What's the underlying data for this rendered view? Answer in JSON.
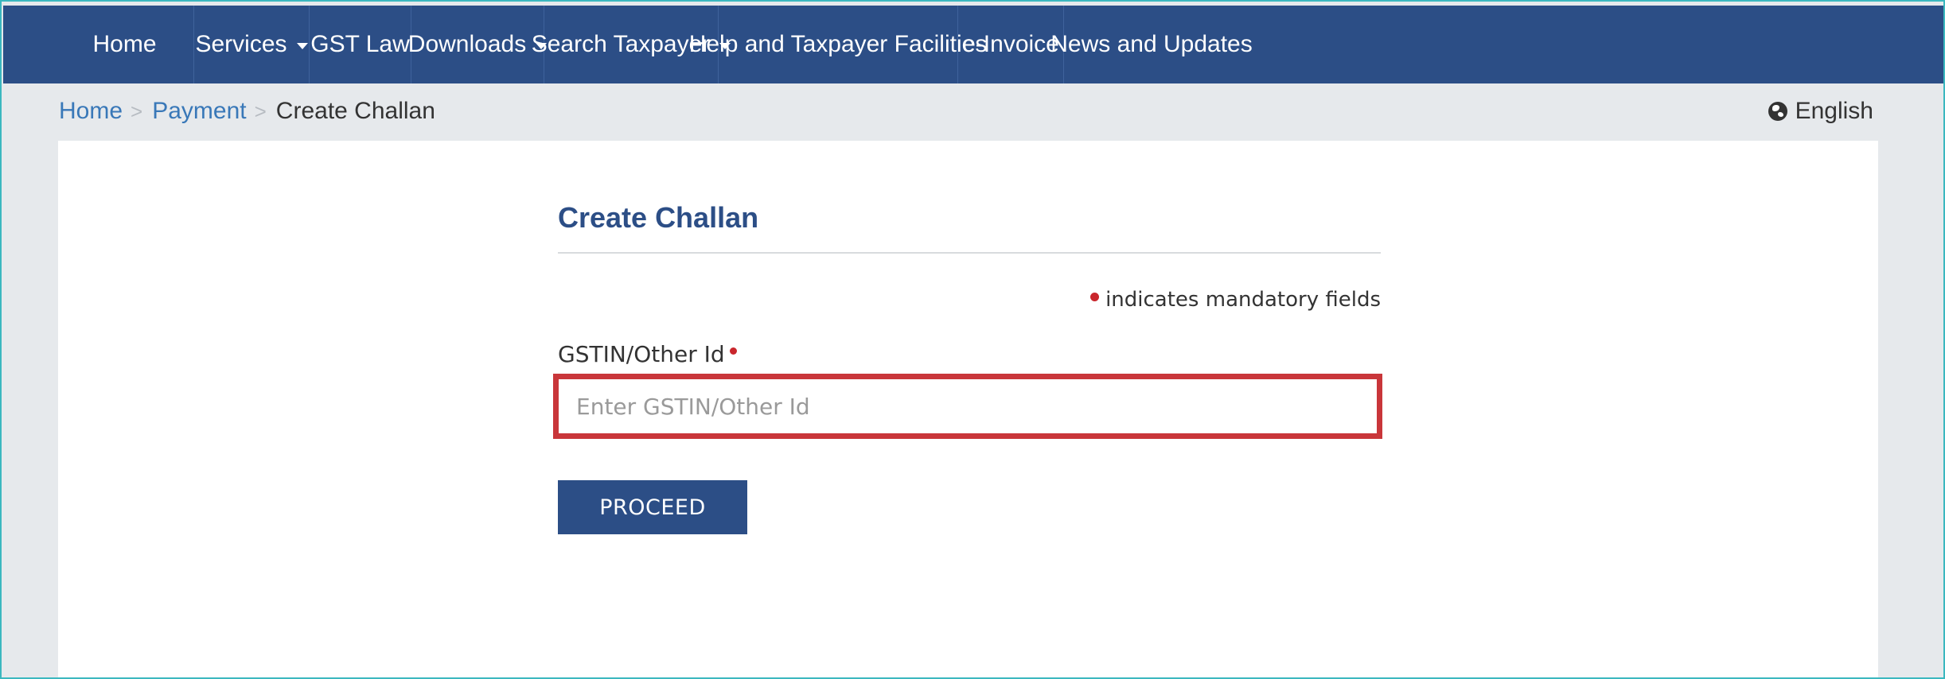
{
  "nav": {
    "items": [
      {
        "label": "Home",
        "dropdown": false
      },
      {
        "label": "Services",
        "dropdown": true
      },
      {
        "label": "GST Law",
        "dropdown": false
      },
      {
        "label": "Downloads",
        "dropdown": true
      },
      {
        "label": "Search Taxpayer",
        "dropdown": true
      },
      {
        "label": "Help and Taxpayer Facilities",
        "dropdown": false
      },
      {
        "label": "e-Invoice",
        "dropdown": false
      },
      {
        "label": "News and Updates",
        "dropdown": false
      }
    ]
  },
  "breadcrumb": {
    "items": [
      "Home",
      "Payment"
    ],
    "separator": ">",
    "current": "Create Challan"
  },
  "language": {
    "label": "English",
    "icon": "globe-icon"
  },
  "form": {
    "title": "Create Challan",
    "mandatory_note": "indicates mandatory fields",
    "field_label": "GSTIN/Other Id",
    "field_value": "",
    "field_placeholder": "Enter GSTIN/Other Id",
    "proceed_label": "PROCEED"
  },
  "colors": {
    "nav_bg": "#2c4e86",
    "link": "#3978b8",
    "required": "#c9262c",
    "highlight_border": "#c9363a",
    "page_bg": "#e6e9ec"
  }
}
